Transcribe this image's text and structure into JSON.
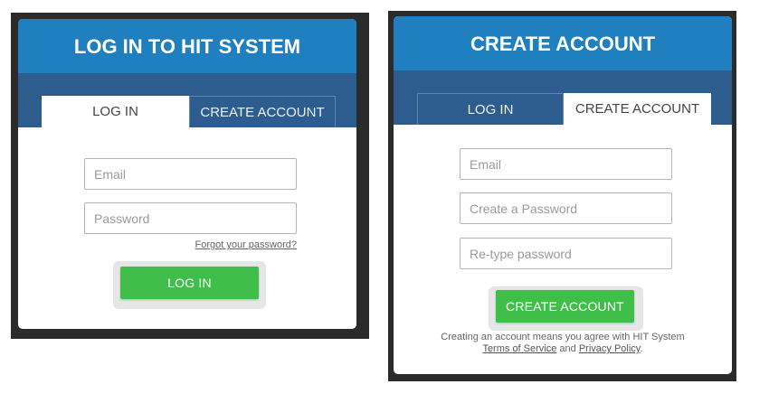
{
  "login": {
    "title": "LOG IN TO HIT SYSTEM",
    "tab_login": "LOG IN",
    "tab_create": "CREATE ACCOUNT",
    "email_placeholder": "Email",
    "password_placeholder": "Password",
    "forgot_link": "Forgot your password?",
    "submit_label": "LOG IN"
  },
  "create": {
    "title": "CREATE ACCOUNT",
    "tab_login": "LOG IN",
    "tab_create": "CREATE ACCOUNT",
    "email_placeholder": "Email",
    "password_placeholder": "Create a Password",
    "retype_placeholder": "Re-type password",
    "submit_label": "CREATE ACCOUNT",
    "terms_prefix": "Creating an account means you agree with HIT System",
    "terms_link": "Terms of Service",
    "terms_and": "and",
    "privacy_link": "Privacy Policy",
    "terms_suffix": "."
  },
  "colors": {
    "header_blue": "#1f7fbf",
    "tabbar_blue": "#2d5d8e",
    "button_green": "#3fbf4a",
    "frame_dark": "#2b2b2b"
  }
}
